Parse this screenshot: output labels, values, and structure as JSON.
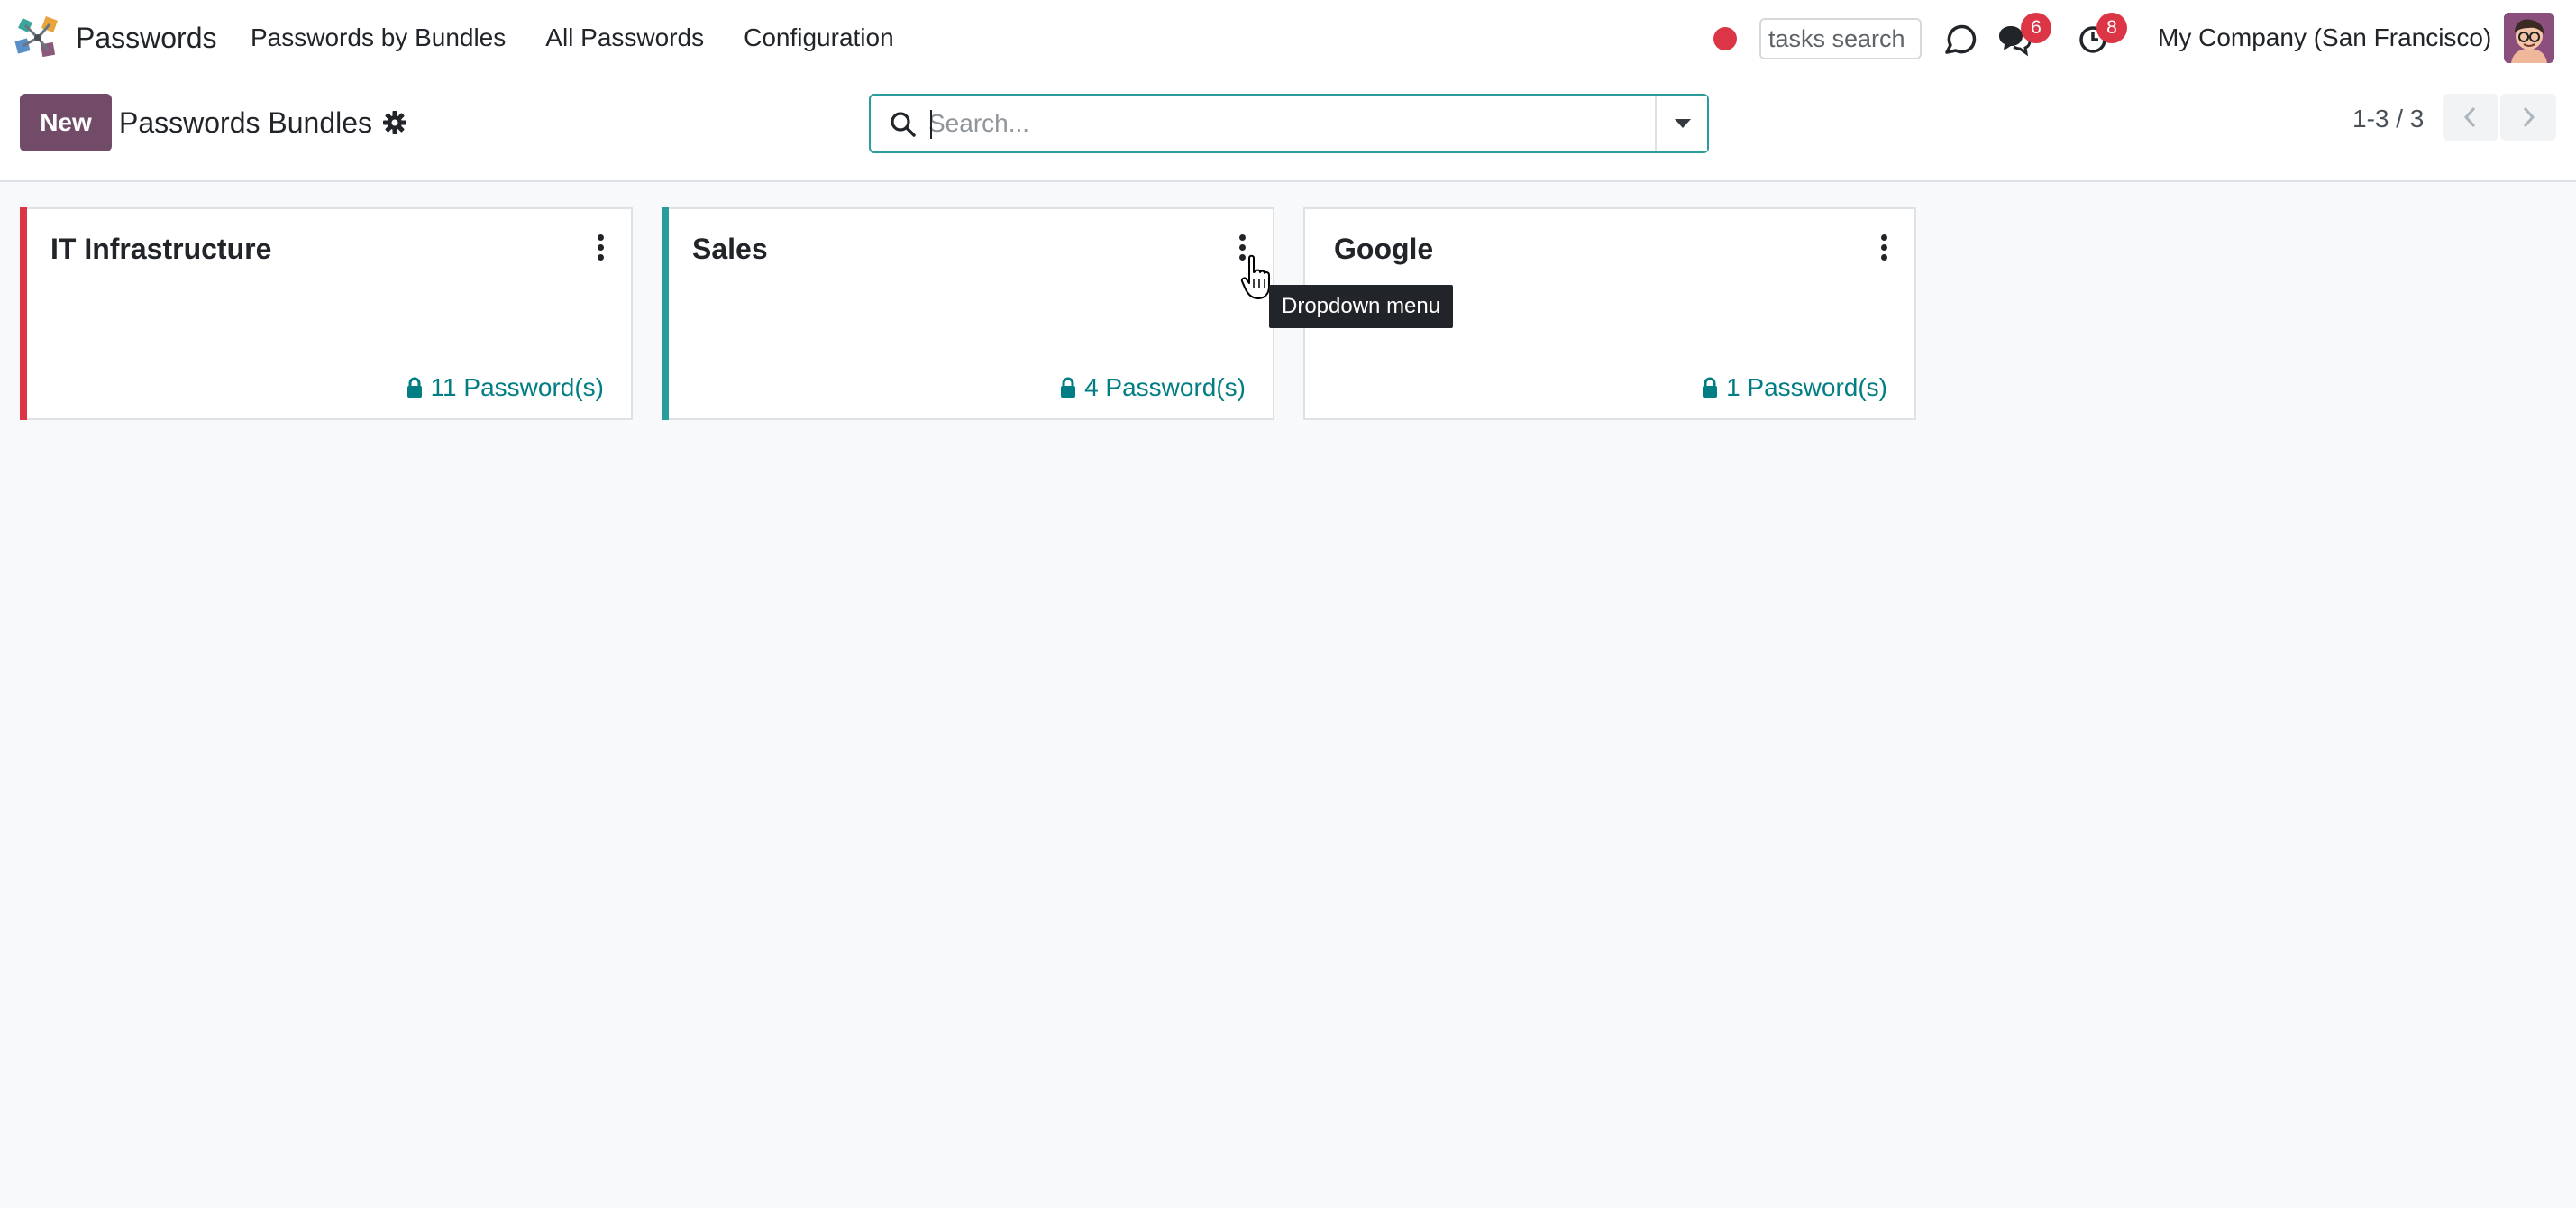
{
  "navbar": {
    "app_name": "Passwords",
    "menu": [
      {
        "label": "Passwords by Bundles"
      },
      {
        "label": "All Passwords"
      },
      {
        "label": "Configuration"
      }
    ],
    "tasks_search_value": "tasks search",
    "messages_badge": "6",
    "activities_badge": "8",
    "company": "My Company (San Francisco)",
    "icons": [
      "app-logo-icon",
      "record-dot-icon",
      "debug-icon",
      "chat-icon",
      "activity-clock-icon",
      "avatar"
    ]
  },
  "control_panel": {
    "new_label": "New",
    "title": "Passwords Bundles",
    "search_placeholder": "Search...",
    "pager": "1-3 / 3"
  },
  "kanban": {
    "cards": [
      {
        "title": "IT Infrastructure",
        "count": "11 Password(s)",
        "color": "#dc3545"
      },
      {
        "title": "Sales",
        "count": "4 Password(s)",
        "color": "#2b9c9c"
      },
      {
        "title": "Google",
        "count": "1 Password(s)",
        "color": "#ffffff"
      }
    ]
  },
  "tooltip": {
    "text": "Dropdown menu"
  },
  "colors": {
    "brand": "#714b67",
    "accent": "#017e84",
    "badge": "#dc3545"
  }
}
